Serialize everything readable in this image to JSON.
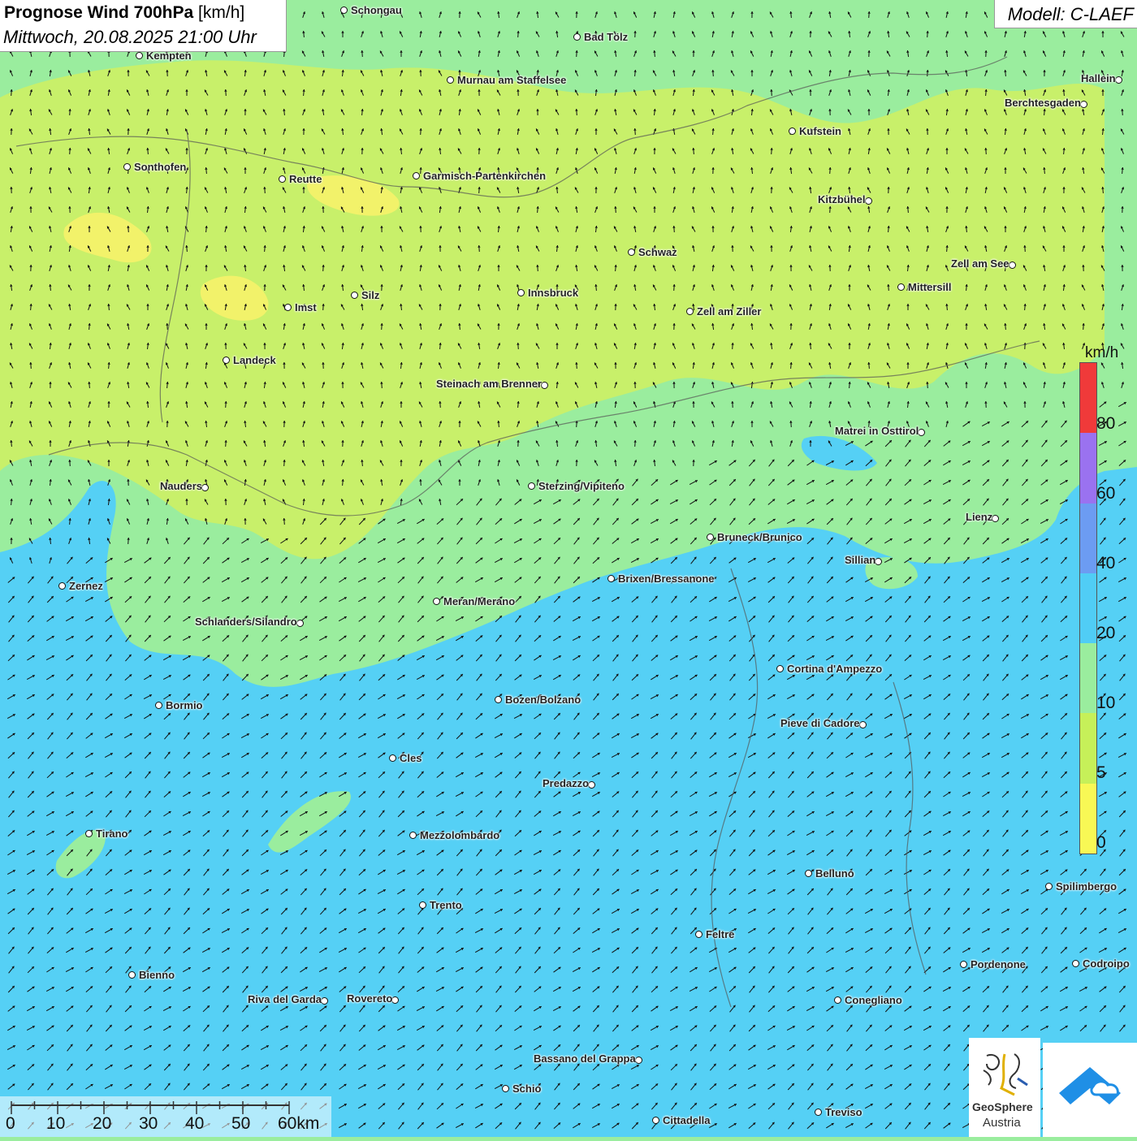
{
  "header": {
    "title_bold": "Prognose Wind 700hPa",
    "title_unit": "[km/h]",
    "datetime": "Mittwoch, 20.08.2025 21:00 Uhr",
    "model": "Modell: C-LAEF"
  },
  "legend": {
    "unit": "km/h",
    "ticks": [
      "0",
      "5",
      "10",
      "20",
      "40",
      "60",
      "80"
    ],
    "colors": [
      "#f8f855",
      "#c6f059",
      "#9aed9e",
      "#50cdf5",
      "#6c9cf2",
      "#9a72f0",
      "#f03a3a"
    ]
  },
  "colors": {
    "calm": "#c8f06a",
    "light": "#9aed9e",
    "moderate": "#55d0f5",
    "very_calm": "#f2f26a"
  },
  "scalebar": {
    "labels": [
      "0",
      "10",
      "20",
      "30",
      "40",
      "50",
      "60km"
    ]
  },
  "logo": {
    "line1": "GeoSphere",
    "line2": "Austria"
  },
  "cities": [
    {
      "name": "Schongau",
      "label_side": "right"
    },
    {
      "name": "Bad Tölz",
      "label_side": "right"
    },
    {
      "name": "Kempten",
      "label_side": "right"
    },
    {
      "name": "Hallein",
      "label_side": "left"
    },
    {
      "name": "Murnau am Staffelsee",
      "label_side": "right"
    },
    {
      "name": "Berchtesgaden",
      "label_side": "left"
    },
    {
      "name": "Kufstein",
      "label_side": "right"
    },
    {
      "name": "Sonthofen",
      "label_side": "right"
    },
    {
      "name": "Reutte",
      "label_side": "right"
    },
    {
      "name": "Garmisch-Partenkirchen",
      "label_side": "right"
    },
    {
      "name": "Kitzbühel",
      "label_side": "left"
    },
    {
      "name": "Schwaz",
      "label_side": "right"
    },
    {
      "name": "Zell am See",
      "label_side": "left"
    },
    {
      "name": "Innsbruck",
      "label_side": "right"
    },
    {
      "name": "Mittersill",
      "label_side": "right"
    },
    {
      "name": "Silz",
      "label_side": "right"
    },
    {
      "name": "Imst",
      "label_side": "right"
    },
    {
      "name": "Zell am Ziller",
      "label_side": "right"
    },
    {
      "name": "Landeck",
      "label_side": "right"
    },
    {
      "name": "Steinach am Brenner",
      "label_side": "left"
    },
    {
      "name": "Matrei in Osttirol",
      "label_side": "left"
    },
    {
      "name": "Nauders",
      "label_side": "left"
    },
    {
      "name": "Sterzing/Vipiteno",
      "label_side": "right"
    },
    {
      "name": "Lienz",
      "label_side": "left"
    },
    {
      "name": "Bruneck/Brunico",
      "label_side": "right"
    },
    {
      "name": "Sillian",
      "label_side": "left"
    },
    {
      "name": "Brixen/Bressanone",
      "label_side": "right"
    },
    {
      "name": "Zernez",
      "label_side": "right"
    },
    {
      "name": "Meran/Merano",
      "label_side": "right"
    },
    {
      "name": "Schlanders/Silandro",
      "label_side": "left"
    },
    {
      "name": "Cortina d'Ampezzo",
      "label_side": "right"
    },
    {
      "name": "Bozen/Bolzano",
      "label_side": "right"
    },
    {
      "name": "Bormio",
      "label_side": "right"
    },
    {
      "name": "Pieve di Cadore",
      "label_side": "left"
    },
    {
      "name": "Cles",
      "label_side": "right"
    },
    {
      "name": "Predazzo",
      "label_side": "left"
    },
    {
      "name": "Tirano",
      "label_side": "right"
    },
    {
      "name": "Mezzolombardo",
      "label_side": "right"
    },
    {
      "name": "Belluno",
      "label_side": "right"
    },
    {
      "name": "Spilimbergo",
      "label_side": "right"
    },
    {
      "name": "Trento",
      "label_side": "right"
    },
    {
      "name": "Feltre",
      "label_side": "right"
    },
    {
      "name": "Pordenone",
      "label_side": "right"
    },
    {
      "name": "Codroipo",
      "label_side": "right"
    },
    {
      "name": "Bienno",
      "label_side": "right"
    },
    {
      "name": "Riva del Garda",
      "label_side": "left"
    },
    {
      "name": "Rovereto",
      "label_side": "left"
    },
    {
      "name": "Conegliano",
      "label_side": "right"
    },
    {
      "name": "Bassano del Grappa",
      "label_side": "left"
    },
    {
      "name": "Schio",
      "label_side": "right"
    },
    {
      "name": "Treviso",
      "label_side": "right"
    },
    {
      "name": "Cittadella",
      "label_side": "right"
    }
  ]
}
